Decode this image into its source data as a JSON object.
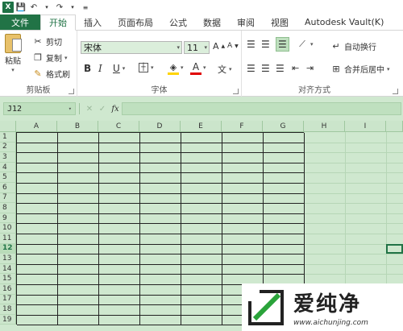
{
  "tabs": [
    "文件",
    "开始",
    "插入",
    "页面布局",
    "公式",
    "数据",
    "审阅",
    "视图",
    "Autodesk Vault(K)"
  ],
  "active_tab": "开始",
  "clipboard": {
    "paste": "粘贴",
    "cut": "剪切",
    "copy": "复制",
    "format_painter": "格式刷",
    "group": "剪贴板"
  },
  "font": {
    "name": "宋体",
    "size": "11",
    "bold": "B",
    "italic": "I",
    "underline": "U",
    "font_color": "A",
    "wen": "文",
    "group": "字体"
  },
  "alignment": {
    "wrap_text": "自动换行",
    "merge_center": "合并后居中",
    "group": "对齐方式"
  },
  "formula_bar": {
    "cell_ref": "J12",
    "fx": "fx",
    "cancel": "✕",
    "enter": "✓"
  },
  "columns": [
    "A",
    "B",
    "C",
    "D",
    "E",
    "F",
    "G",
    "H",
    "I"
  ],
  "rows": [
    "1",
    "2",
    "3",
    "4",
    "5",
    "6",
    "7",
    "8",
    "9",
    "10",
    "11",
    "12",
    "13",
    "14",
    "15",
    "16",
    "17",
    "18",
    "19"
  ],
  "selected_row": "12",
  "watermark": {
    "title": "爱纯净",
    "url": "www.aichunjing.com"
  },
  "colors": {
    "excel_green": "#217346",
    "grid_bg": "#cfe8cf"
  }
}
